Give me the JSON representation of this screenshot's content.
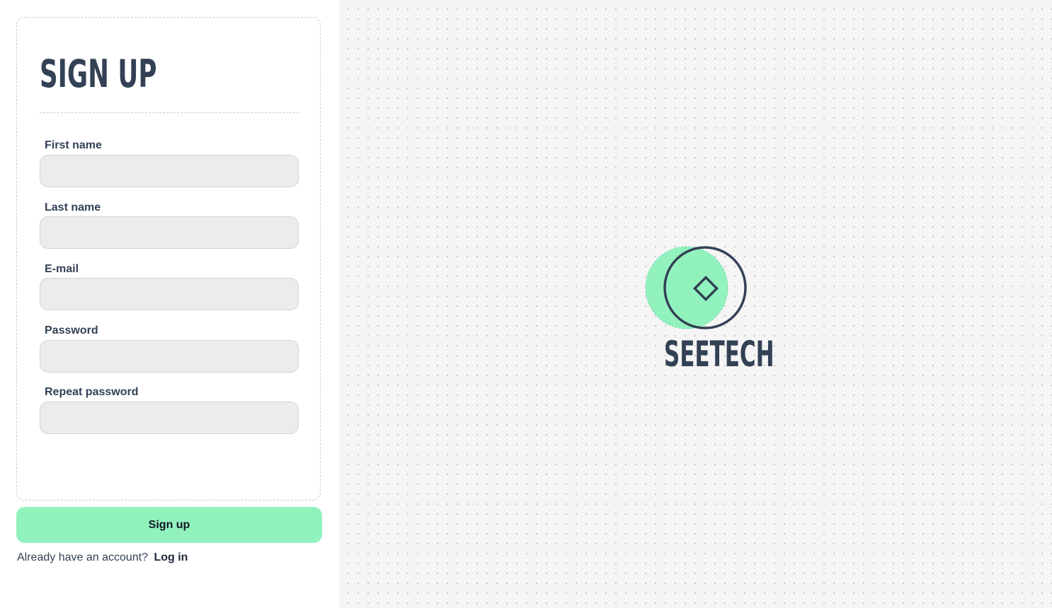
{
  "signup_form": {
    "title": "SIGN UP",
    "fields": [
      {
        "label": "First name",
        "value": "",
        "type": "text"
      },
      {
        "label": "Last name",
        "value": "",
        "type": "text"
      },
      {
        "label": "E-mail",
        "value": "",
        "type": "email"
      },
      {
        "label": "Password",
        "value": "",
        "type": "password"
      },
      {
        "label": "Repeat password",
        "value": "",
        "type": "password"
      }
    ],
    "submit_label": "Sign up",
    "login_prompt": "Already have an account?",
    "login_link": "Log in"
  },
  "brand": {
    "name": "SEETECH",
    "logo_icon": "circle-diamond-logo-icon"
  },
  "colors": {
    "accent": "#92f2be",
    "text": "#334155",
    "input_bg": "#ececec",
    "canvas_bg": "#f5f5f5"
  }
}
